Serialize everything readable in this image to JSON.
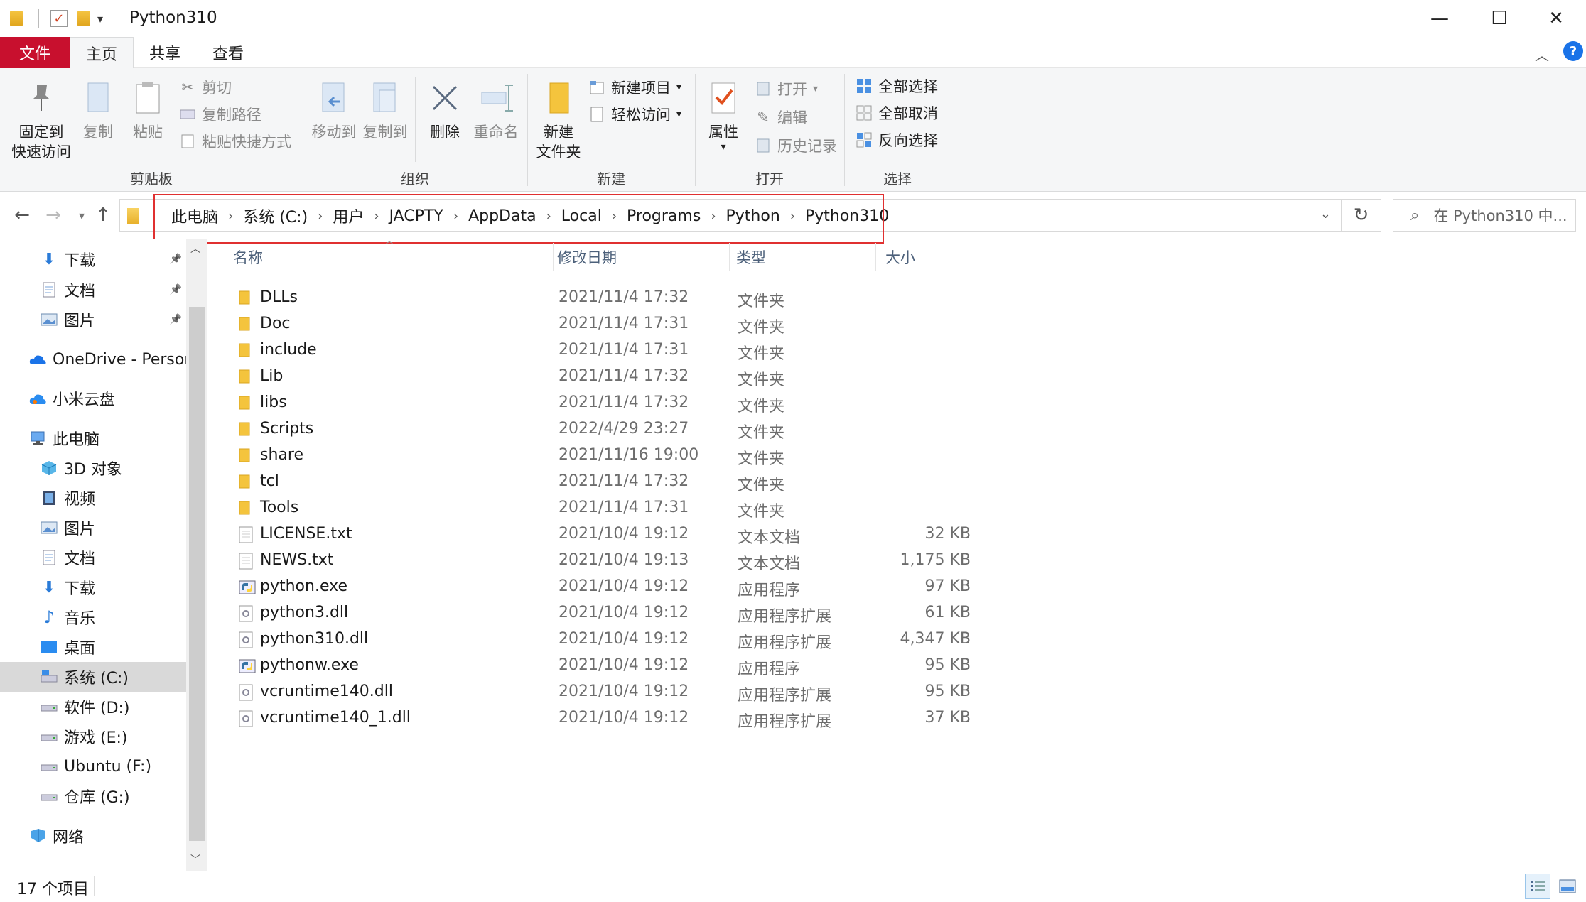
{
  "window": {
    "title": "Python310",
    "controls": {
      "minimize": "—",
      "maximize": "☐",
      "close": "✕"
    }
  },
  "tabs": {
    "file": "文件",
    "home": "主页",
    "share": "共享",
    "view": "查看"
  },
  "ribbon": {
    "clipboard": {
      "label": "剪贴板",
      "pin_line1": "固定到",
      "pin_line2": "快速访问",
      "copy": "复制",
      "paste": "粘贴",
      "cut": "剪切",
      "copy_path": "复制路径",
      "paste_shortcut": "粘贴快捷方式"
    },
    "organize": {
      "label": "组织",
      "move_to": "移动到",
      "copy_to": "复制到",
      "delete": "删除",
      "rename": "重命名"
    },
    "new": {
      "label": "新建",
      "new_folder_line1": "新建",
      "new_folder_line2": "文件夹",
      "new_item": "新建项目",
      "easy_access": "轻松访问"
    },
    "open": {
      "label": "打开",
      "properties": "属性",
      "open": "打开",
      "edit": "编辑",
      "history": "历史记录"
    },
    "select": {
      "label": "选择",
      "select_all": "全部选择",
      "select_none": "全部取消",
      "invert": "反向选择"
    }
  },
  "address": {
    "crumbs": [
      "此电脑",
      "系统 (C:)",
      "用户",
      "JACPTY",
      "AppData",
      "Local",
      "Programs",
      "Python",
      "Python310"
    ],
    "search_placeholder": "在 Python310 中..."
  },
  "sidebar": {
    "items": [
      {
        "label": "下载",
        "icon": "download-arrow-icon",
        "pinned": true
      },
      {
        "label": "文档",
        "icon": "document-icon",
        "pinned": true
      },
      {
        "label": "图片",
        "icon": "picture-icon",
        "pinned": true
      },
      {
        "label": "OneDrive - Person",
        "icon": "onedrive-cloud-icon"
      },
      {
        "label": "小米云盘",
        "icon": "xiaomi-cloud-icon"
      },
      {
        "label": "此电脑",
        "icon": "computer-icon"
      },
      {
        "label": "3D 对象",
        "icon": "3d-objects-icon"
      },
      {
        "label": "视频",
        "icon": "video-icon"
      },
      {
        "label": "图片",
        "icon": "picture-icon"
      },
      {
        "label": "文档",
        "icon": "document-icon"
      },
      {
        "label": "下载",
        "icon": "download-arrow-icon"
      },
      {
        "label": "音乐",
        "icon": "music-note-icon"
      },
      {
        "label": "桌面",
        "icon": "desktop-icon"
      },
      {
        "label": "系统 (C:)",
        "icon": "system-drive-icon",
        "selected": true
      },
      {
        "label": "软件 (D:)",
        "icon": "drive-icon"
      },
      {
        "label": "游戏 (E:)",
        "icon": "drive-icon"
      },
      {
        "label": "Ubuntu (F:)",
        "icon": "drive-icon"
      },
      {
        "label": "仓库 (G:)",
        "icon": "drive-icon"
      },
      {
        "label": "网络",
        "icon": "network-icon"
      }
    ]
  },
  "columns": {
    "name": "名称",
    "date": "修改日期",
    "type": "类型",
    "size": "大小"
  },
  "files": [
    {
      "name": "DLLs",
      "date": "2021/11/4 17:32",
      "type": "文件夹",
      "size": "",
      "kind": "folder"
    },
    {
      "name": "Doc",
      "date": "2021/11/4 17:31",
      "type": "文件夹",
      "size": "",
      "kind": "folder"
    },
    {
      "name": "include",
      "date": "2021/11/4 17:31",
      "type": "文件夹",
      "size": "",
      "kind": "folder"
    },
    {
      "name": "Lib",
      "date": "2021/11/4 17:32",
      "type": "文件夹",
      "size": "",
      "kind": "folder"
    },
    {
      "name": "libs",
      "date": "2021/11/4 17:32",
      "type": "文件夹",
      "size": "",
      "kind": "folder"
    },
    {
      "name": "Scripts",
      "date": "2022/4/29 23:27",
      "type": "文件夹",
      "size": "",
      "kind": "folder"
    },
    {
      "name": "share",
      "date": "2021/11/16 19:00",
      "type": "文件夹",
      "size": "",
      "kind": "folder"
    },
    {
      "name": "tcl",
      "date": "2021/11/4 17:32",
      "type": "文件夹",
      "size": "",
      "kind": "folder"
    },
    {
      "name": "Tools",
      "date": "2021/11/4 17:31",
      "type": "文件夹",
      "size": "",
      "kind": "folder"
    },
    {
      "name": "LICENSE.txt",
      "date": "2021/10/4 19:12",
      "type": "文本文档",
      "size": "32 KB",
      "kind": "doc"
    },
    {
      "name": "NEWS.txt",
      "date": "2021/10/4 19:13",
      "type": "文本文档",
      "size": "1,175 KB",
      "kind": "doc"
    },
    {
      "name": "python.exe",
      "date": "2021/10/4 19:12",
      "type": "应用程序",
      "size": "97 KB",
      "kind": "exe"
    },
    {
      "name": "python3.dll",
      "date": "2021/10/4 19:12",
      "type": "应用程序扩展",
      "size": "61 KB",
      "kind": "dll"
    },
    {
      "name": "python310.dll",
      "date": "2021/10/4 19:12",
      "type": "应用程序扩展",
      "size": "4,347 KB",
      "kind": "dll"
    },
    {
      "name": "pythonw.exe",
      "date": "2021/10/4 19:12",
      "type": "应用程序",
      "size": "95 KB",
      "kind": "exe"
    },
    {
      "name": "vcruntime140.dll",
      "date": "2021/10/4 19:12",
      "type": "应用程序扩展",
      "size": "95 KB",
      "kind": "dll"
    },
    {
      "name": "vcruntime140_1.dll",
      "date": "2021/10/4 19:12",
      "type": "应用程序扩展",
      "size": "37 KB",
      "kind": "dll"
    }
  ],
  "status": {
    "item_count": "17 个项目"
  },
  "colors": {
    "file_tab": "#c8102e",
    "highlight_box": "#e03030",
    "selected_nav": "#d9d9d9"
  }
}
